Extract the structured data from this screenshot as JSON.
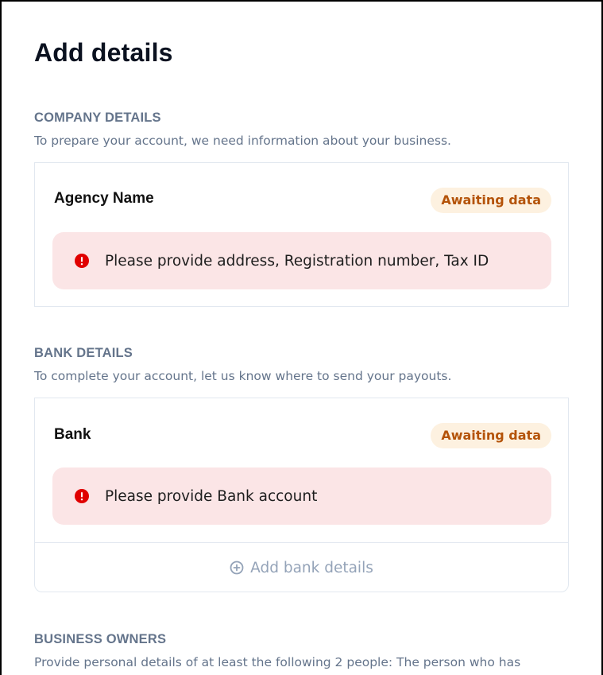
{
  "page": {
    "title": "Add details"
  },
  "company": {
    "heading": "COMPANY DETAILS",
    "description": "To prepare your account, we need information about your business.",
    "card": {
      "title": "Agency Name",
      "badge": "Awaiting data",
      "alert_icon": "error-icon",
      "alert_text": "Please provide address, Registration number, Tax ID"
    }
  },
  "bank": {
    "heading": "BANK DETAILS",
    "description": "To complete your account, let us know where to send your payouts.",
    "card": {
      "title": "Bank",
      "badge": "Awaiting data",
      "alert_icon": "error-icon",
      "alert_text": "Please provide Bank account",
      "add_icon": "plus-circle-icon",
      "add_label": "Add bank details"
    }
  },
  "owners": {
    "heading": "BUSINESS OWNERS",
    "description": "Provide personal details of at least the following 2 people: The person who has"
  },
  "colors": {
    "badge_bg": "#fdf1e0",
    "badge_text": "#b45309",
    "alert_bg": "#fbe5e6",
    "error_icon": "#e00000",
    "muted_text": "#64748b"
  }
}
